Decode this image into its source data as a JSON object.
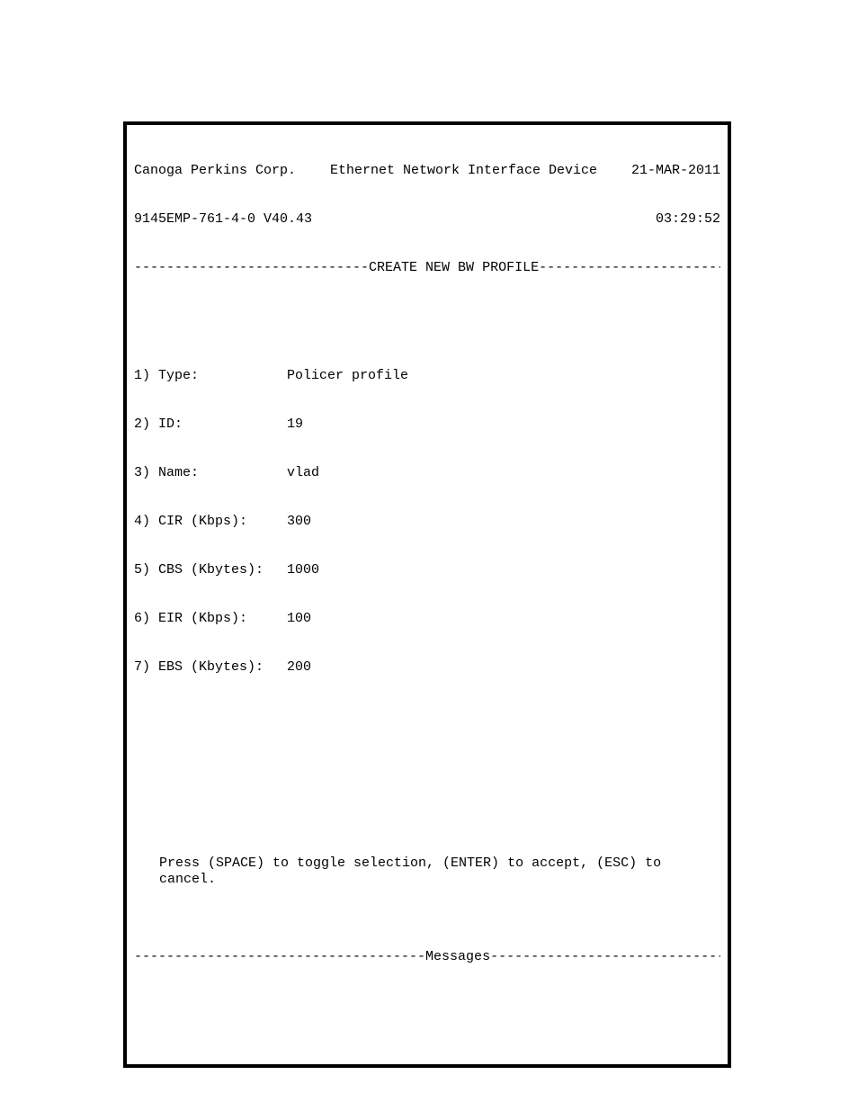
{
  "header": {
    "company": "Canoga Perkins Corp.",
    "device_title": "Ethernet Network Interface Device",
    "date": "21-MAR-2011",
    "model_version": "9145EMP-761-4-0 V40.43",
    "time": "03:29:52"
  },
  "section_divider": "-----------------------------CREATE NEW BW PROFILE------------------------------",
  "fields": [
    {
      "num": "1)",
      "label": "Type:",
      "value": "Policer profile"
    },
    {
      "num": "2)",
      "label": "ID:",
      "value": "19"
    },
    {
      "num": "3)",
      "label": "Name:",
      "value": "vlad"
    },
    {
      "num": "4)",
      "label": "CIR (Kbps):",
      "value": "300"
    },
    {
      "num": "5)",
      "label": "CBS (Kbytes):",
      "value": "1000"
    },
    {
      "num": "6)",
      "label": "EIR (Kbps):",
      "value": "100"
    },
    {
      "num": "7)",
      "label": "EBS (Kbytes):",
      "value": "200"
    }
  ],
  "instructions": "Press (SPACE) to toggle selection, (ENTER) to accept, (ESC) to cancel.",
  "messages_divider": "------------------------------------Messages------------------------------------"
}
